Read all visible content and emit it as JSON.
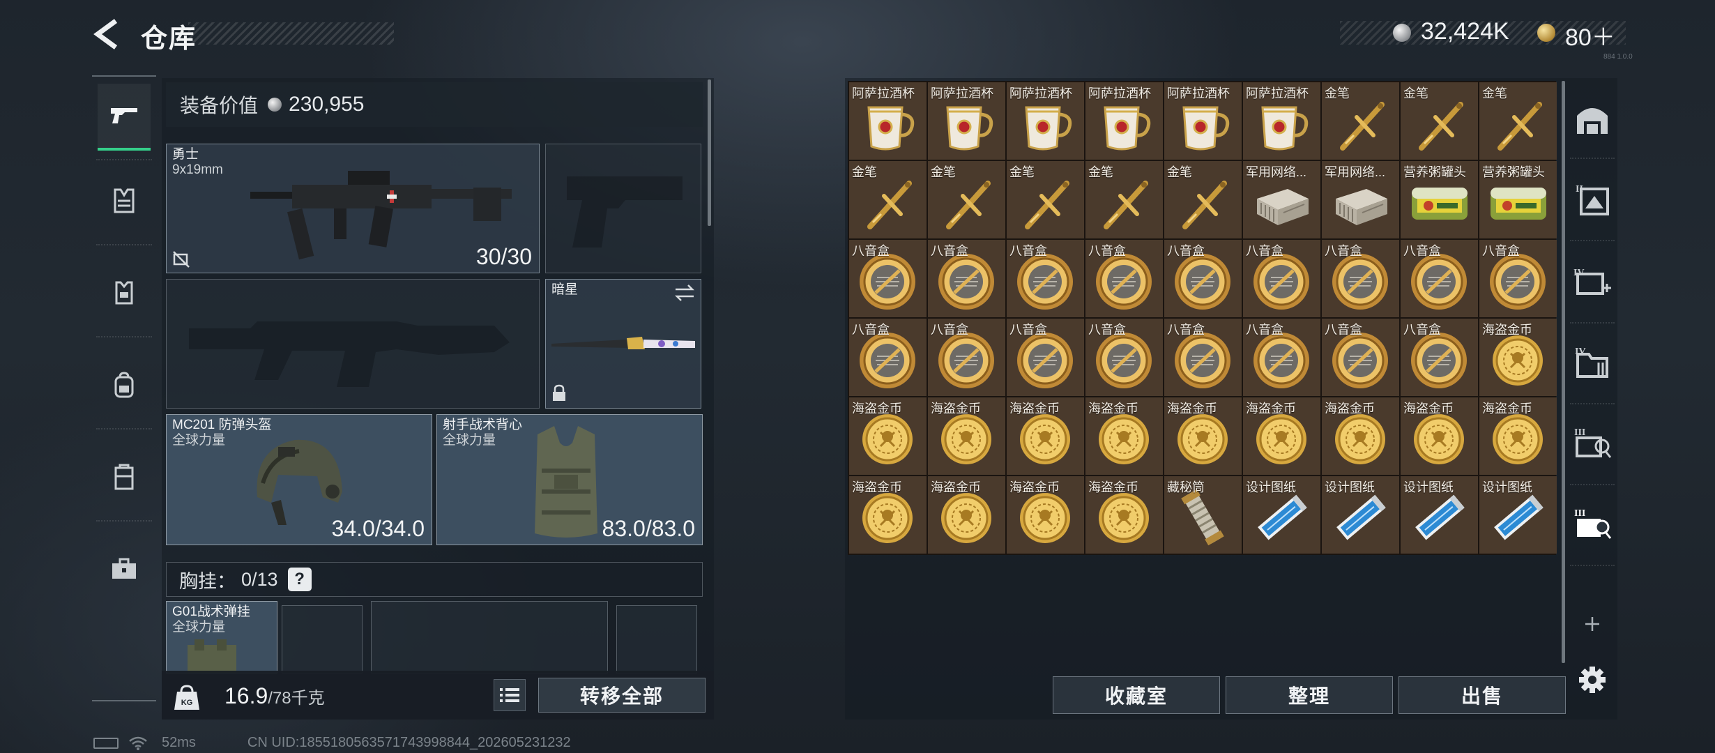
{
  "header": {
    "title": "仓库",
    "silver": "32,424K",
    "gold": "80＋",
    "version": "884 1.0.0"
  },
  "equipment": {
    "value_label": "装备价值",
    "value": "230,955",
    "primary": {
      "name": "勇士",
      "caliber": "9x19mm",
      "ammo": "30/30"
    },
    "melee": {
      "name": "暗星"
    },
    "helmet": {
      "name": "MC201 防弹头盔",
      "maker": "全球力量",
      "durability": "34.0/34.0"
    },
    "armor": {
      "name": "射手战术背心",
      "maker": "全球力量",
      "durability": "83.0/83.0"
    },
    "chest": {
      "label": "胸挂：",
      "count": "0/13",
      "help": "?"
    },
    "rig": {
      "name": "G01战术弹挂",
      "maker": "全球力量"
    }
  },
  "bottom": {
    "weight": "16.9",
    "weight_max": "/78千克",
    "transfer_all": "转移全部"
  },
  "storage": {
    "items": [
      {
        "label": "阿萨拉酒杯",
        "icon": "cup-icon"
      },
      {
        "label": "阿萨拉酒杯",
        "icon": "cup-icon"
      },
      {
        "label": "阿萨拉酒杯",
        "icon": "cup-icon"
      },
      {
        "label": "阿萨拉酒杯",
        "icon": "cup-icon"
      },
      {
        "label": "阿萨拉酒杯",
        "icon": "cup-icon"
      },
      {
        "label": "阿萨拉酒杯",
        "icon": "cup-icon"
      },
      {
        "label": "金笔",
        "icon": "pen-icon"
      },
      {
        "label": "金笔",
        "icon": "pen-icon"
      },
      {
        "label": "金笔",
        "icon": "pen-icon"
      },
      {
        "label": "金笔",
        "icon": "pen-icon"
      },
      {
        "label": "金笔",
        "icon": "pen-icon"
      },
      {
        "label": "金笔",
        "icon": "pen-icon"
      },
      {
        "label": "金笔",
        "icon": "pen-icon"
      },
      {
        "label": "金笔",
        "icon": "pen-icon"
      },
      {
        "label": "军用网络...",
        "icon": "network-device-icon"
      },
      {
        "label": "军用网络...",
        "icon": "network-device-icon"
      },
      {
        "label": "营养粥罐头",
        "icon": "can-icon"
      },
      {
        "label": "营养粥罐头",
        "icon": "can-icon"
      },
      {
        "label": "八音盒",
        "icon": "music-box-icon"
      },
      {
        "label": "八音盒",
        "icon": "music-box-icon"
      },
      {
        "label": "八音盒",
        "icon": "music-box-icon"
      },
      {
        "label": "八音盒",
        "icon": "music-box-icon"
      },
      {
        "label": "八音盒",
        "icon": "music-box-icon"
      },
      {
        "label": "八音盒",
        "icon": "music-box-icon"
      },
      {
        "label": "八音盒",
        "icon": "music-box-icon"
      },
      {
        "label": "八音盒",
        "icon": "music-box-icon"
      },
      {
        "label": "八音盒",
        "icon": "music-box-icon"
      },
      {
        "label": "八音盒",
        "icon": "music-box-icon"
      },
      {
        "label": "八音盒",
        "icon": "music-box-icon"
      },
      {
        "label": "八音盒",
        "icon": "music-box-icon"
      },
      {
        "label": "八音盒",
        "icon": "music-box-icon"
      },
      {
        "label": "八音盒",
        "icon": "music-box-icon"
      },
      {
        "label": "八音盒",
        "icon": "music-box-icon"
      },
      {
        "label": "八音盒",
        "icon": "music-box-icon"
      },
      {
        "label": "八音盒",
        "icon": "music-box-icon"
      },
      {
        "label": "海盗金币",
        "icon": "pirate-coin-icon"
      },
      {
        "label": "海盗金币",
        "icon": "pirate-coin-icon"
      },
      {
        "label": "海盗金币",
        "icon": "pirate-coin-icon"
      },
      {
        "label": "海盗金币",
        "icon": "pirate-coin-icon"
      },
      {
        "label": "海盗金币",
        "icon": "pirate-coin-icon"
      },
      {
        "label": "海盗金币",
        "icon": "pirate-coin-icon"
      },
      {
        "label": "海盗金币",
        "icon": "pirate-coin-icon"
      },
      {
        "label": "海盗金币",
        "icon": "pirate-coin-icon"
      },
      {
        "label": "海盗金币",
        "icon": "pirate-coin-icon"
      },
      {
        "label": "海盗金币",
        "icon": "pirate-coin-icon"
      },
      {
        "label": "海盗金币",
        "icon": "pirate-coin-icon"
      },
      {
        "label": "海盗金币",
        "icon": "pirate-coin-icon"
      },
      {
        "label": "海盗金币",
        "icon": "pirate-coin-icon"
      },
      {
        "label": "海盗金币",
        "icon": "pirate-coin-icon"
      },
      {
        "label": "藏秘筒",
        "icon": "cryptex-icon"
      },
      {
        "label": "设计图纸",
        "icon": "blueprint-icon"
      },
      {
        "label": "设计图纸",
        "icon": "blueprint-icon"
      },
      {
        "label": "设计图纸",
        "icon": "blueprint-icon"
      },
      {
        "label": "设计图纸",
        "icon": "blueprint-icon"
      }
    ],
    "buttons": {
      "collection": "收藏室",
      "organize": "整理",
      "sell": "出售"
    }
  },
  "status": {
    "ping": "52ms",
    "uid": "CN UID:1855180563571743998844_202605231232"
  }
}
